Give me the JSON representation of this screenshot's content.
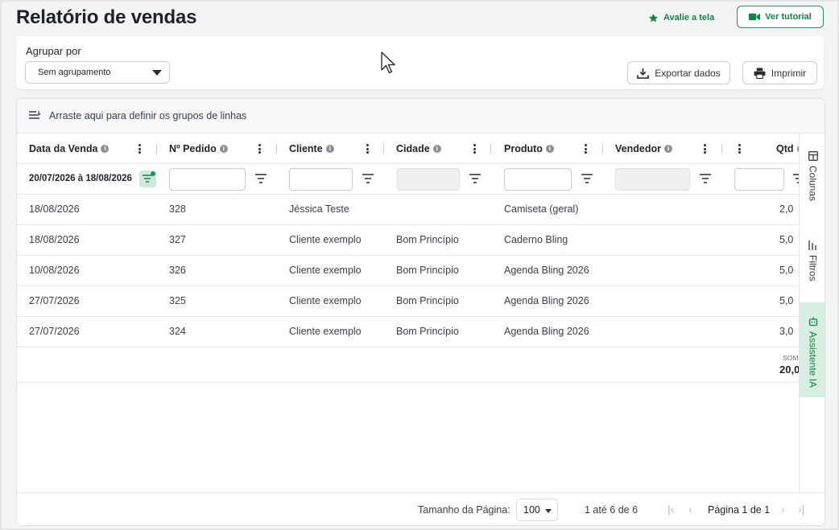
{
  "header": {
    "title": "Relatório de vendas",
    "rate_label": "Avalie a tela",
    "tutorial_label": "Ver tutorial",
    "accent_color": "#17804a"
  },
  "grouping": {
    "label": "Agrupar por",
    "selected": "Sem agrupamento",
    "export_label": "Exportar dados",
    "print_label": "Imprimir"
  },
  "grid": {
    "drag_zone_text": "Arraste aqui para definir os grupos de linhas",
    "columns": [
      {
        "label": "Data da Venda"
      },
      {
        "label": "Nº Pedido"
      },
      {
        "label": "Cliente"
      },
      {
        "label": "Cidade"
      },
      {
        "label": "Produto"
      },
      {
        "label": "Vendedor"
      },
      {
        "label": "Qtd"
      }
    ],
    "date_filter_value": "20/07/2026 à 18/08/2026",
    "rows": [
      {
        "data": "18/08/2026",
        "pedido": "328",
        "cliente": "Jéssica Teste",
        "cidade": "",
        "produto": "Camiseta (geral)",
        "vendedor": "",
        "qtd": "2,0"
      },
      {
        "data": "18/08/2026",
        "pedido": "327",
        "cliente": "Cliente exemplo",
        "cidade": "Bom Princípio",
        "produto": "Caderno Bling",
        "vendedor": "",
        "qtd": "5,0"
      },
      {
        "data": "10/08/2026",
        "pedido": "326",
        "cliente": "Cliente exemplo",
        "cidade": "Bom Princípio",
        "produto": "Agenda Bling 2026",
        "vendedor": "",
        "qtd": "5,0"
      },
      {
        "data": "27/07/2026",
        "pedido": "325",
        "cliente": "Cliente exemplo",
        "cidade": "Bom Princípio",
        "produto": "Agenda Bling 2026",
        "vendedor": "",
        "qtd": "5,0"
      },
      {
        "data": "27/07/2026",
        "pedido": "324",
        "cliente": "Cliente exemplo",
        "cidade": "Bom Princípio",
        "produto": "Agenda Bling 2026",
        "vendedor": "",
        "qtd": "3,0"
      }
    ],
    "sum_label": "SOM",
    "sum_value": "20,0"
  },
  "side_panel": {
    "columns_label": "Colunas",
    "filters_label": "Filtros",
    "ai_label": "Assistente IA"
  },
  "footer": {
    "page_size_label": "Tamanho da Página:",
    "page_size": "100",
    "range_text": "1 até 6 de 6",
    "page_text": "Página 1 de 1"
  }
}
